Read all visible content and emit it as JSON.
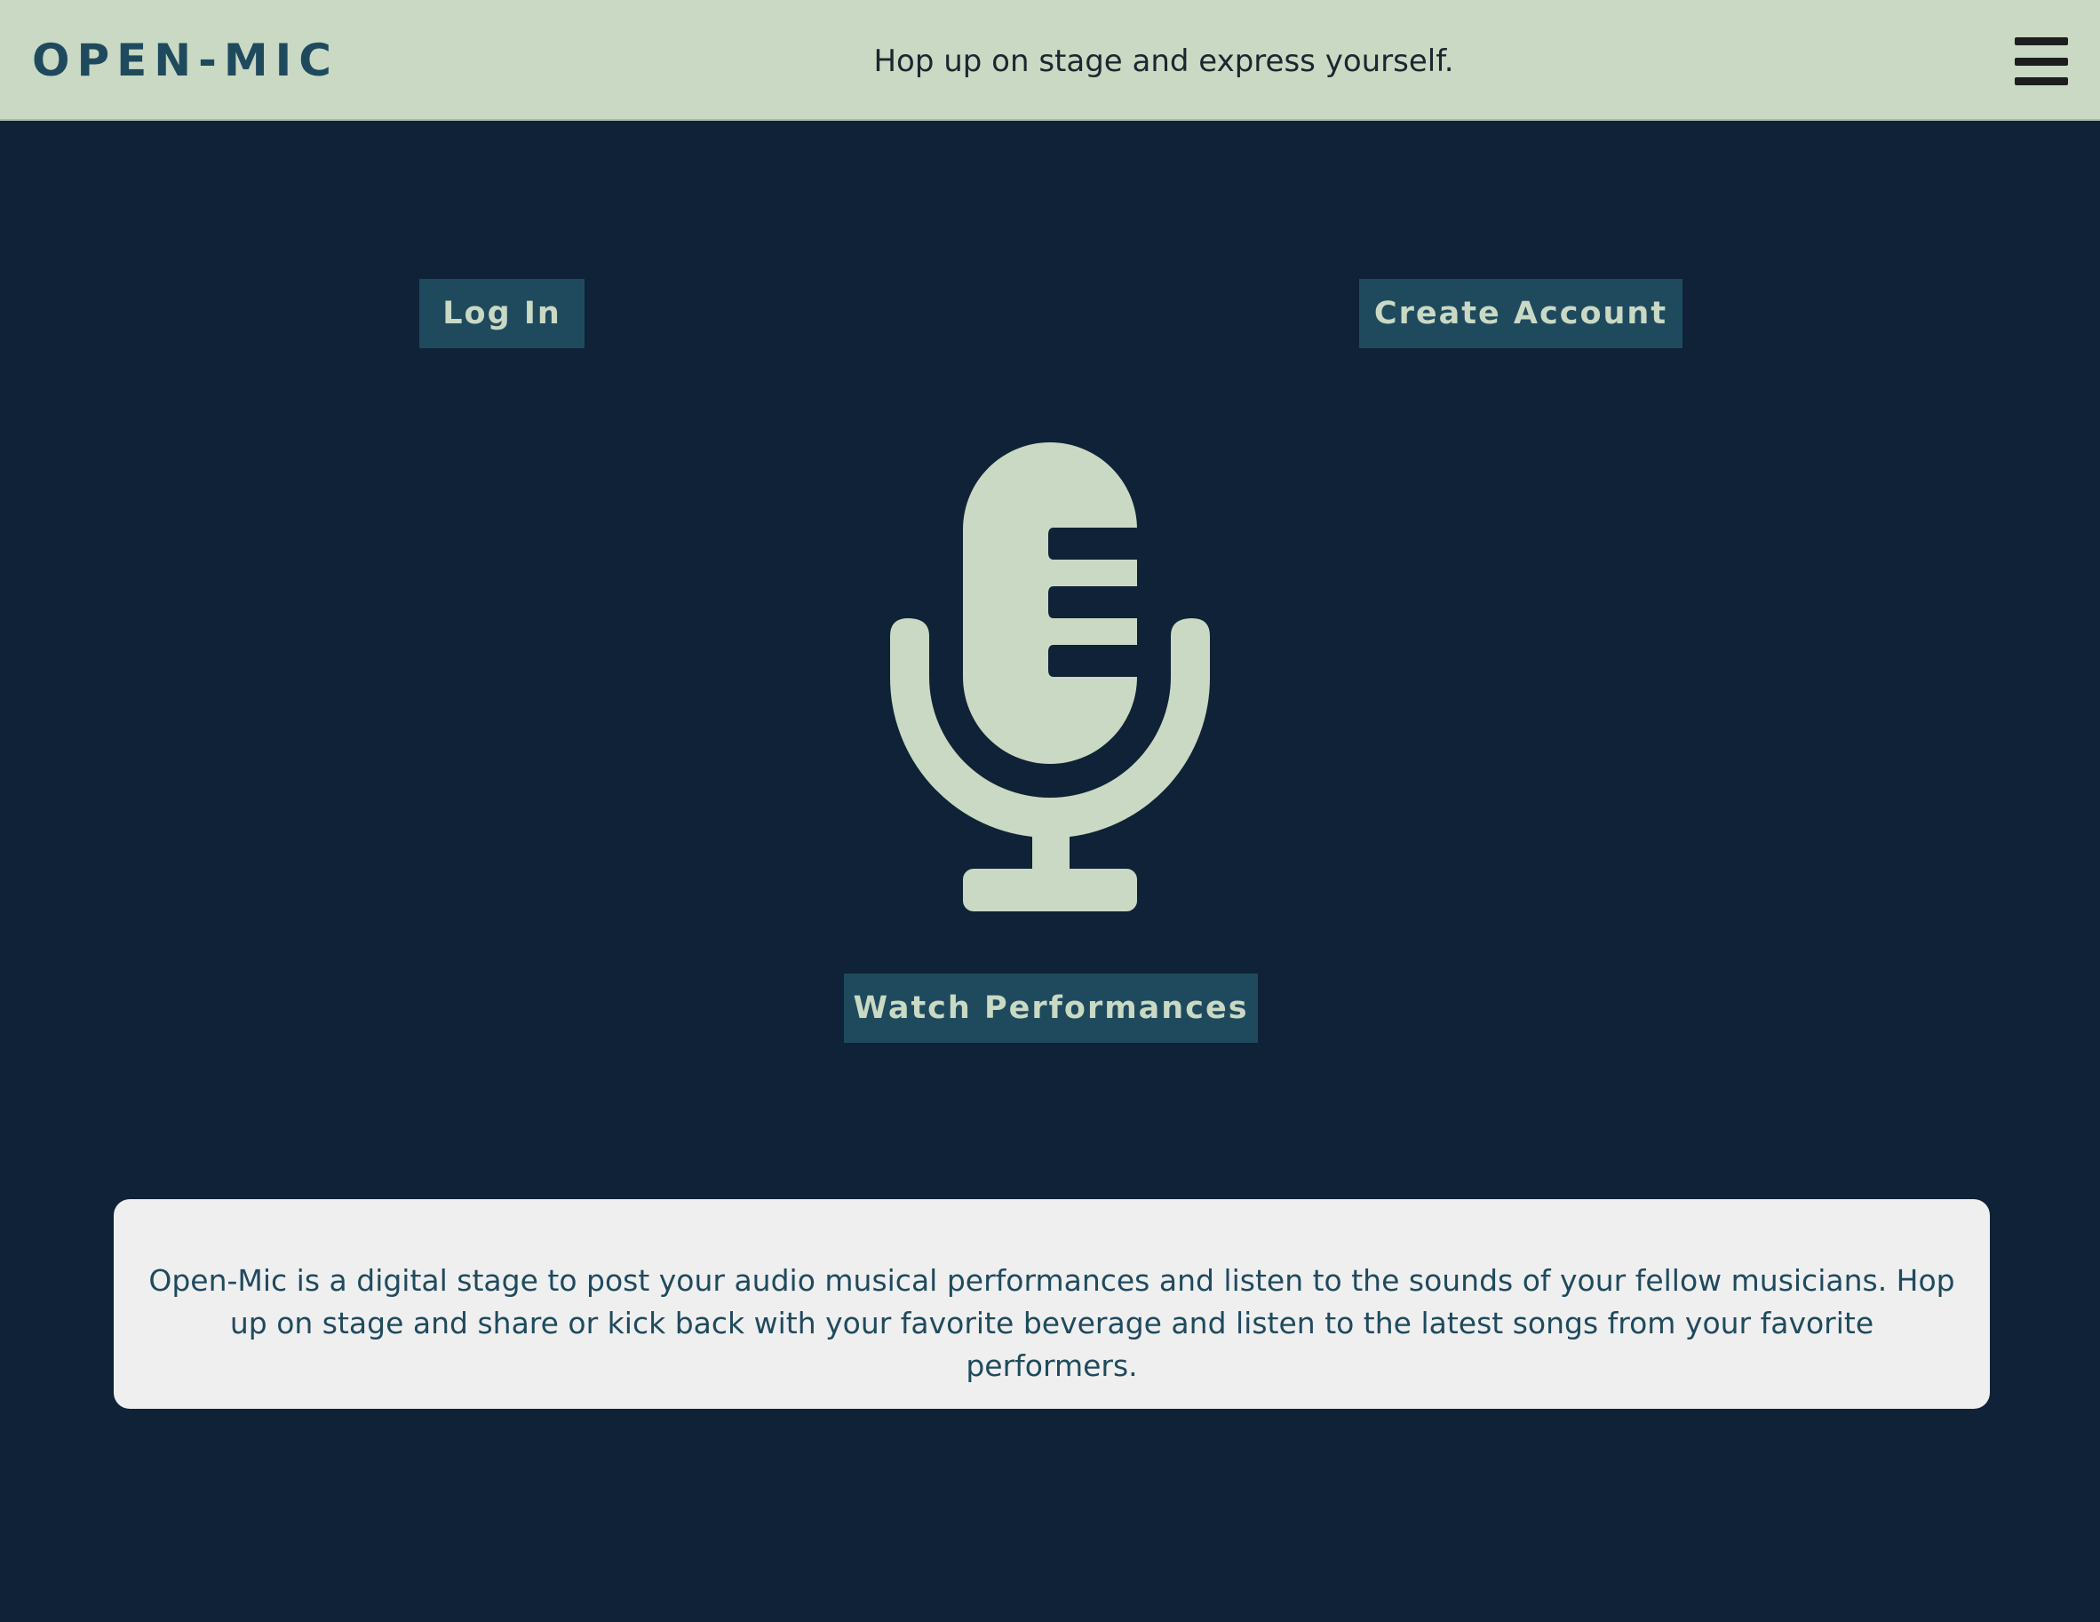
{
  "header": {
    "logo": "OPEN-MIC",
    "tagline": "Hop up on stage and express yourself.",
    "menu_icon": "hamburger-menu-icon"
  },
  "actions": {
    "login_label": "Log In",
    "create_account_label": "Create Account",
    "watch_label": "Watch Performances"
  },
  "hero": {
    "icon": "microphone-icon"
  },
  "about": {
    "text": "Open-Mic is a digital stage to post your audio musical performances and listen to the sounds of your fellow musicians. Hop up on stage and share or kick back with your favorite beverage and listen to the latest songs from your favorite performers."
  },
  "colors": {
    "background": "#0f2237",
    "header": "#c9d9c3",
    "button": "#1f4a5e",
    "button_text": "#c9d9c3",
    "accent": "#1f4a5e",
    "card": "#efefef"
  }
}
